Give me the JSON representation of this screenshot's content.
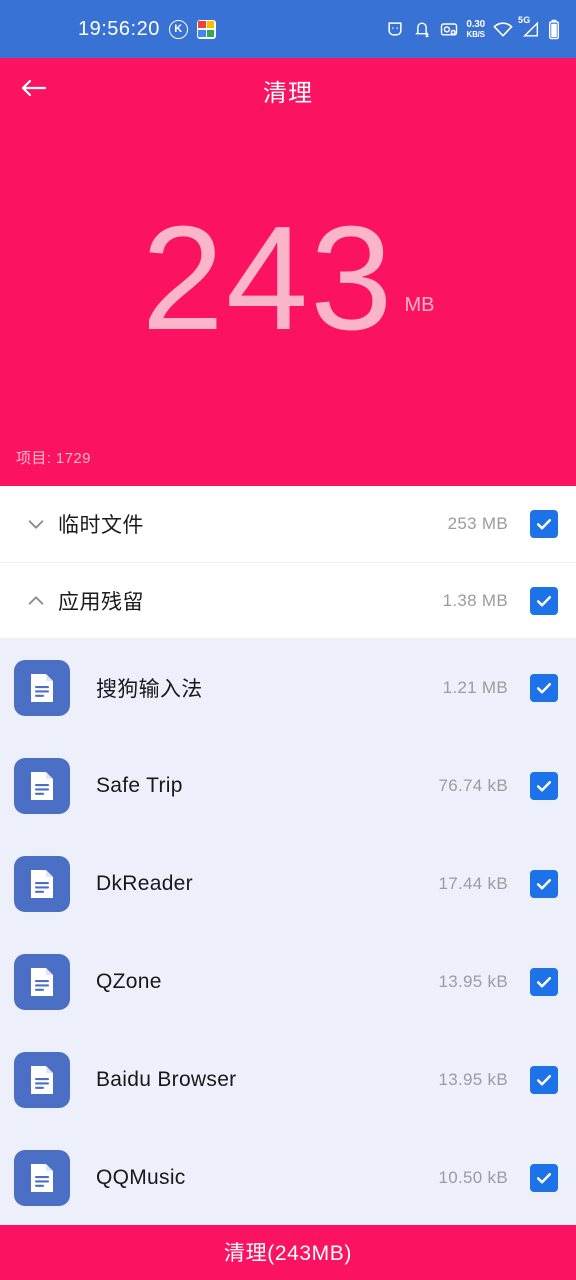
{
  "statusbar": {
    "time": "19:56:20",
    "left_icons": [
      "circled-k-icon",
      "app-grid-icon"
    ],
    "net_speed_value": "0.30",
    "net_speed_unit": "KB/S",
    "network_type": "5G",
    "right_icons": [
      "shield-icon",
      "notification-off-icon",
      "screenshot-icon",
      "wifi-icon",
      "signal-icon",
      "battery-icon"
    ],
    "bg_color": "#3872D4"
  },
  "header": {
    "title": "清理",
    "back_icon": "arrow-left-icon",
    "bg_color": "#FB1260"
  },
  "hero": {
    "amount": "243",
    "unit": "MB",
    "items_label": "项目: 1729",
    "number_color": "#FBB5C9"
  },
  "categories": [
    {
      "label": "临时文件",
      "size": "253 MB",
      "chevron": "chevron-down-icon",
      "expanded": false,
      "checked": true
    },
    {
      "label": "应用残留",
      "size": "1.38 MB",
      "chevron": "chevron-up-icon",
      "expanded": true,
      "checked": true
    }
  ],
  "apps": [
    {
      "name": "搜狗输入法",
      "size": "1.21 MB",
      "icon": "file-document-icon",
      "checked": true
    },
    {
      "name": "Safe Trip",
      "size": "76.74 kB",
      "icon": "file-document-icon",
      "checked": true
    },
    {
      "name": "DkReader",
      "size": "17.44 kB",
      "icon": "file-document-icon",
      "checked": true
    },
    {
      "name": "QZone",
      "size": "13.95 kB",
      "icon": "file-document-icon",
      "checked": true
    },
    {
      "name": "Baidu Browser",
      "size": "13.95 kB",
      "icon": "file-document-icon",
      "checked": true
    },
    {
      "name": "QQMusic",
      "size": "10.50 kB",
      "icon": "file-document-icon",
      "checked": true
    }
  ],
  "bottom": {
    "clean_label": "清理(243MB)",
    "bg_color": "#FB1260"
  },
  "colors": {
    "accent_pink": "#FB1260",
    "status_blue": "#3872D4",
    "checkbox_blue": "#1D72E8",
    "sublist_bg": "#EDEFFA",
    "app_icon_blue": "#4A6FC4"
  }
}
